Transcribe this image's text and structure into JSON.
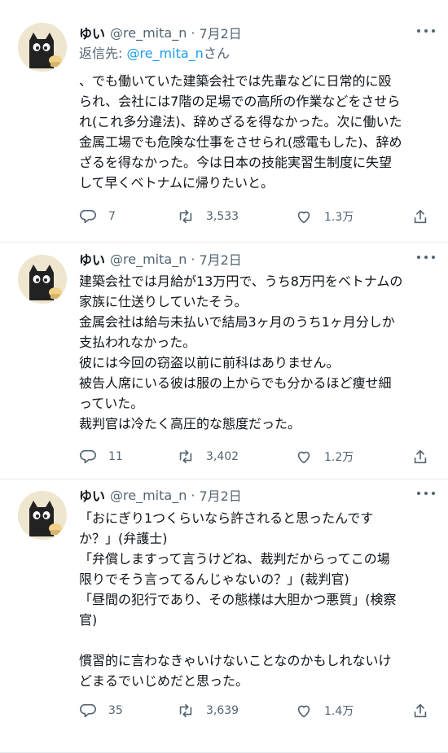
{
  "tweets": [
    {
      "name": "ゆい",
      "handle": "@re_mita_n",
      "dot": "·",
      "date": "7月2日",
      "reply_prefix": "返信先: ",
      "reply_mention": "@re_mita_n",
      "reply_suffix": "さん",
      "lines": [
        "、でも働いていた建築会社では先輩などに日常的に殴",
        "られ、会社には7階の足場での高所の作業などをさせら",
        "れ(これ多分違法)、辞めざるを得なかった。次に働いた",
        "金属工場でも危険な仕事をさせられ(感電もした)、辞め",
        "ざるを得なかった。今は日本の技能実習生制度に失望",
        "して早くベトナムに帰りたいと。"
      ],
      "replies": "7",
      "retweets": "3,533",
      "likes": "1.3万"
    },
    {
      "name": "ゆい",
      "handle": "@re_mita_n",
      "dot": "·",
      "date": "7月2日",
      "lines": [
        "建築会社では月給が13万円で、うち8万円をベトナムの",
        "家族に仕送りしていたそう。",
        "金属会社は給与未払いで結局3ヶ月のうち1ヶ月分しか",
        "支払われなかった。",
        "彼には今回の窃盗以前に前科はありません。",
        "被告人席にいる彼は服の上からでも分かるほど痩せ細",
        "っていた。",
        "裁判官は冷たく高圧的な態度だった。"
      ],
      "replies": "11",
      "retweets": "3,402",
      "likes": "1.2万"
    },
    {
      "name": "ゆい",
      "handle": "@re_mita_n",
      "dot": "·",
      "date": "7月2日",
      "lines": [
        "「おにぎり1つくらいなら許されると思ったんです",
        "か？」(弁護士)",
        "「弁償しますって言うけどね、裁判だからってこの場",
        "限りでそう言ってるんじゃないの？」(裁判官)",
        "「昼間の犯行であり、その態様は大胆かつ悪質」(検察",
        "官)",
        "",
        "慣習的に言わなきゃいけないことなのかもしれないけ",
        "どまるでいじめだと思った。"
      ],
      "replies": "35",
      "retweets": "3,639",
      "likes": "1.4万"
    }
  ],
  "icons": {
    "reply": "reply-icon",
    "retweet": "retweet-icon",
    "like": "heart-icon",
    "share": "share-icon",
    "more": "more-icon"
  },
  "colors": {
    "link": "#1d9bf0",
    "muted": "#536471",
    "text": "#0f1419",
    "divider": "#e6ecf0"
  }
}
